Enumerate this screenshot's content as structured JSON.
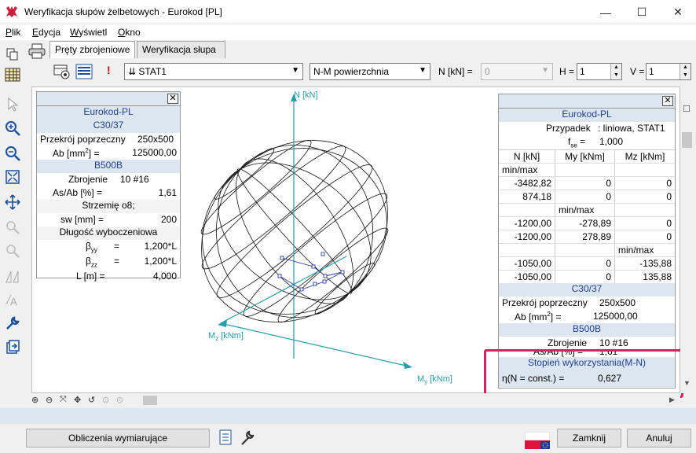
{
  "window": {
    "title": "Weryfikacja słupów żelbetowych - Eurokod [PL]",
    "minimize_glyph": "—",
    "maximize_glyph": "☐",
    "close_glyph": "✕"
  },
  "menu": [
    "Plik",
    "Edycja",
    "Wyświetl",
    "Okno"
  ],
  "tabs": [
    "Pręty zbrojeniowe",
    "Weryfikacja słupa"
  ],
  "toolbar": {
    "alert_glyph": "!",
    "case_select": "⇊ STAT1",
    "view_select": "N-M powierzchnia",
    "n_label": "N [kN] =",
    "n_value": "0",
    "h_label": "H =",
    "h_value": "1",
    "v_label": "V =",
    "v_value": "1"
  },
  "axes": {
    "n": "N [kN]",
    "mz_main": "M",
    "mz_sub": "z",
    "mz_unit": " [kNm]",
    "my_main": "M",
    "my_sub": "y",
    "my_unit": " [kNm]"
  },
  "left_panel": {
    "close_glyph": "✕",
    "standard": "Eurokod-PL",
    "concrete": "C30/37",
    "section_label": "Przekrój poprzeczny",
    "section_value": "250x500",
    "ab_label_main": "Ab [mm",
    "ab_label_sup": "2",
    "ab_label_end": "] =",
    "ab_value": "125000,00",
    "steel": "B500B",
    "reinf_label": "Zbrojenie",
    "reinf_value": "10 #16",
    "asab_label": "As/Ab [%] =",
    "asab_value": "1,61",
    "stirrup": "Strzemię o8;",
    "sw_label": "sw [mm] =",
    "sw_value": "200",
    "buckling": "Długość wyboczeniowa",
    "byy_main": "β",
    "byy_sub": "yy",
    "byy_eq": "=",
    "byy_value": "1,200*L",
    "bzz_main": "β",
    "bzz_sub": "zz",
    "bzz_eq": "=",
    "bzz_value": "1,200*L",
    "l_label": "L [m] =",
    "l_value": "4,000"
  },
  "right_panel": {
    "close_glyph": "✕",
    "standard": "Eurokod-PL",
    "case_label": "Przypadek",
    "case_value": ": liniowa, STAT1",
    "fse_main": "f",
    "fse_sub": "se",
    "fse_eq": " = ",
    "fse_value": "1,000",
    "columns": [
      "N [kN]",
      "My [kNm]",
      "Mz [kNm]"
    ],
    "minmax": "min/max",
    "rows": [
      [
        "-3482,82",
        "0",
        "0"
      ],
      [
        "874,18",
        "0",
        "0"
      ],
      [
        "-1200,00",
        "-278,89",
        "0"
      ],
      [
        "-1200,00",
        "278,89",
        "0"
      ],
      [
        "-1050,00",
        "0",
        "-135,88"
      ],
      [
        "-1050,00",
        "0",
        "135,88"
      ]
    ],
    "concrete": "C30/37",
    "section_label": "Przekrój poprzeczny",
    "section_value": "250x500",
    "ab_label_main": "Ab [mm",
    "ab_label_sup": "2",
    "ab_label_end": "] =",
    "ab_value": "125000,00",
    "steel": "B500B",
    "reinf_label": "Zbrojenie",
    "reinf_value": "10 #16",
    "asab_label": "As/Ab [%] =",
    "asab_value": "1,61",
    "util_title": "Stopień wykorzystania(M-N)",
    "util_label": "η(N = const.) =",
    "util_value": "0,627"
  },
  "buttons": {
    "calc": "Obliczenia wymiarujące",
    "close": "Zamknij",
    "cancel": "Anuluj"
  }
}
